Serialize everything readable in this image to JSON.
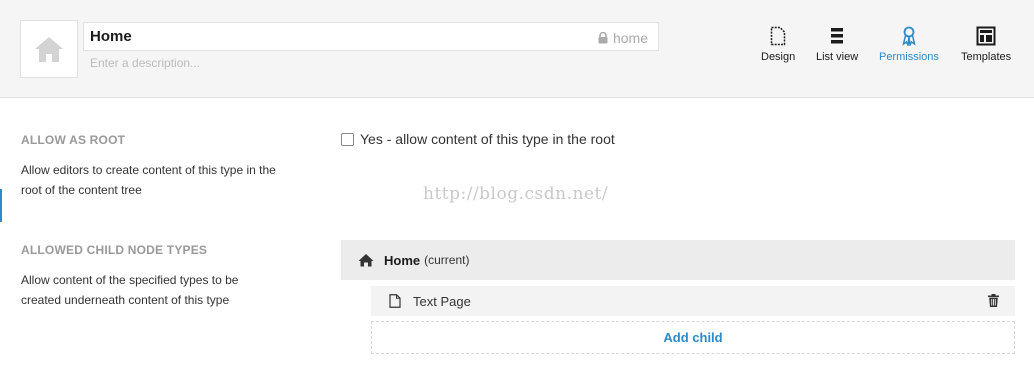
{
  "header": {
    "name_value": "Home",
    "alias": "home",
    "description_placeholder": "Enter a description...",
    "tabs": [
      {
        "label": "Design",
        "icon": "document-icon"
      },
      {
        "label": "List view",
        "icon": "list-icon"
      },
      {
        "label": "Permissions",
        "icon": "badge-icon",
        "active": true
      },
      {
        "label": "Templates",
        "icon": "layout-icon"
      }
    ]
  },
  "allow_root": {
    "title": "ALLOW AS ROOT",
    "description": "Allow editors to create content of this type in the root of the content tree",
    "checkbox_label": "Yes - allow content of this type in the root",
    "checked": false
  },
  "child_types": {
    "title": "ALLOWED CHILD NODE TYPES",
    "description": "Allow content of the specified types to be created underneath content of this type",
    "root_name": "Home",
    "root_suffix": "(current)",
    "children": [
      {
        "name": "Text Page",
        "icon": "document-icon"
      }
    ],
    "add_child_label": "Add child"
  },
  "watermark": "http://blog.csdn.net/",
  "colors": {
    "accent": "#2e8ac7",
    "header_bg": "#f5f5f5",
    "muted_title": "#999999"
  }
}
